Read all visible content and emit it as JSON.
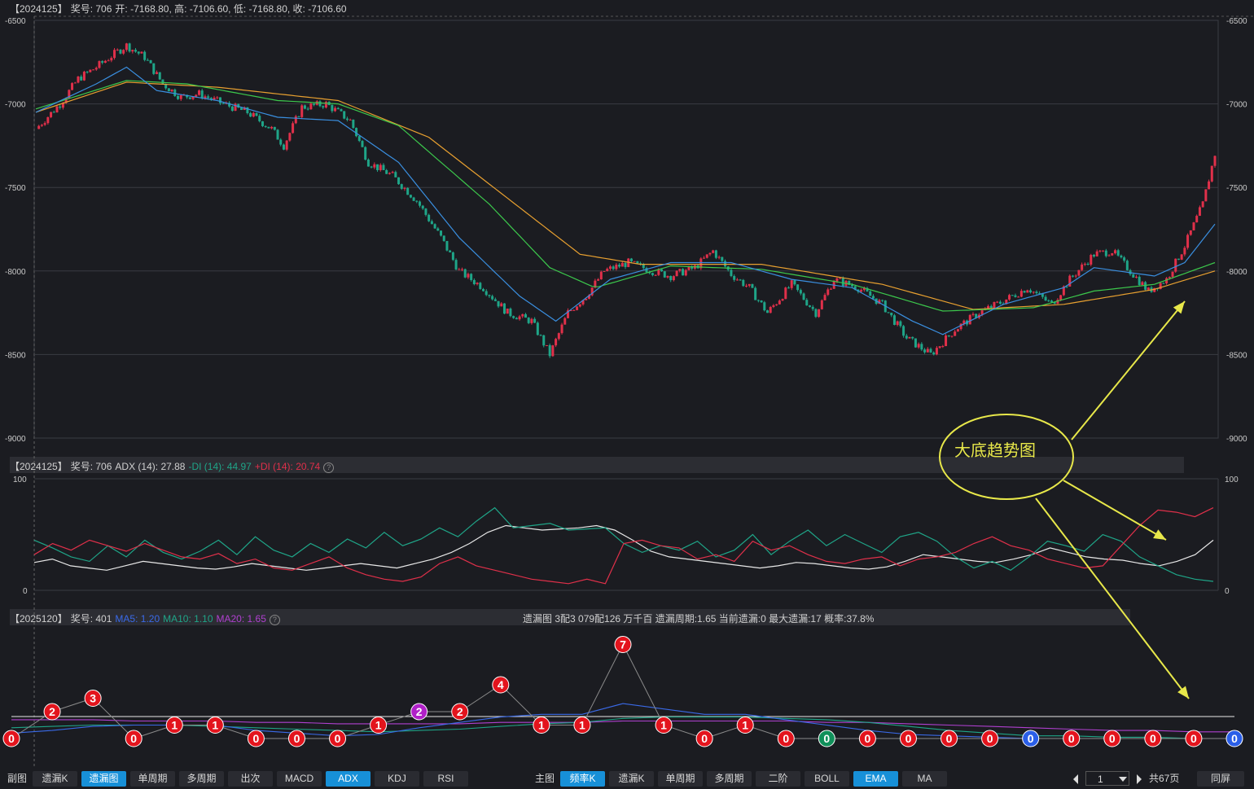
{
  "main_header": {
    "code": "【2024125】",
    "issue": "奖号: 706",
    "ohlc": "开: -7168.80, 高: -7106.60, 低: -7168.80, 收: -7106.60"
  },
  "adx_header": {
    "code": "【2024125】",
    "issue": "奖号: 706",
    "adx": "ADX (14): 27.88",
    "mdi": "-DI (14): 44.97",
    "pdi": "+DI (14): 20.74",
    "help": "?"
  },
  "omit_header": {
    "code": "【2025120】",
    "issue": "奖号: 401",
    "ma5": "MA5: 1.20",
    "ma10": "MA10: 1.10",
    "ma20": "MA20: 1.65",
    "help": "?",
    "info": "遗漏图   3配3   079配126   万千百   遗漏周期:1.65   当前遗漏:0   最大遗漏:17   概率:37.8%"
  },
  "annotation": {
    "text": "大底趋势图"
  },
  "colors": {
    "up": "#e0304a",
    "down": "#1fa588",
    "ma_blue": "#3a8fe0",
    "ma_green": "#3cc84c",
    "ma_orange": "#e8a030",
    "adx_white": "#e8e8e8",
    "annot_yellow": "#e8e84a"
  },
  "chart_data": [
    {
      "type": "candlestick",
      "name": "main",
      "ylim": [
        -9000,
        -6500
      ],
      "yticks": [
        -6500,
        -7000,
        -7500,
        -8000,
        -8500,
        -9000
      ],
      "ytick_labels": [
        "-6500",
        "-7000",
        "-7500",
        "-8000",
        "-8500",
        "-9000"
      ],
      "close_path": [
        [
          0,
          -7150
        ],
        [
          8,
          -7000
        ],
        [
          14,
          -6850
        ],
        [
          20,
          -6780
        ],
        [
          26,
          -6700
        ],
        [
          30,
          -6650
        ],
        [
          36,
          -6720
        ],
        [
          42,
          -6880
        ],
        [
          48,
          -6960
        ],
        [
          54,
          -6940
        ],
        [
          62,
          -7000
        ],
        [
          70,
          -7050
        ],
        [
          78,
          -7150
        ],
        [
          82,
          -7250
        ],
        [
          88,
          -7020
        ],
        [
          96,
          -7000
        ],
        [
          104,
          -7100
        ],
        [
          110,
          -7350
        ],
        [
          118,
          -7430
        ],
        [
          126,
          -7580
        ],
        [
          134,
          -7800
        ],
        [
          140,
          -8000
        ],
        [
          148,
          -8100
        ],
        [
          156,
          -8250
        ],
        [
          164,
          -8300
        ],
        [
          170,
          -8500
        ],
        [
          176,
          -8250
        ],
        [
          182,
          -8150
        ],
        [
          188,
          -8000
        ],
        [
          196,
          -7950
        ],
        [
          204,
          -8000
        ],
        [
          210,
          -8030
        ],
        [
          218,
          -7980
        ],
        [
          224,
          -7880
        ],
        [
          230,
          -8020
        ],
        [
          236,
          -8100
        ],
        [
          242,
          -8250
        ],
        [
          250,
          -8080
        ],
        [
          258,
          -8250
        ],
        [
          264,
          -8050
        ],
        [
          272,
          -8100
        ],
        [
          280,
          -8200
        ],
        [
          288,
          -8400
        ],
        [
          296,
          -8500
        ],
        [
          304,
          -8350
        ],
        [
          312,
          -8250
        ],
        [
          320,
          -8180
        ],
        [
          328,
          -8100
        ],
        [
          336,
          -8200
        ],
        [
          342,
          -8050
        ],
        [
          350,
          -7900
        ],
        [
          356,
          -7880
        ],
        [
          362,
          -8000
        ],
        [
          368,
          -8120
        ],
        [
          374,
          -8050
        ],
        [
          380,
          -7850
        ],
        [
          386,
          -7600
        ],
        [
          390,
          -7300
        ]
      ],
      "ma_blue_path": [
        [
          0,
          -7050
        ],
        [
          20,
          -6880
        ],
        [
          30,
          -6780
        ],
        [
          40,
          -6920
        ],
        [
          60,
          -6980
        ],
        [
          80,
          -7080
        ],
        [
          100,
          -7100
        ],
        [
          120,
          -7350
        ],
        [
          140,
          -7800
        ],
        [
          160,
          -8150
        ],
        [
          172,
          -8300
        ],
        [
          190,
          -8050
        ],
        [
          210,
          -7950
        ],
        [
          230,
          -7950
        ],
        [
          250,
          -8050
        ],
        [
          270,
          -8100
        ],
        [
          290,
          -8300
        ],
        [
          300,
          -8380
        ],
        [
          320,
          -8200
        ],
        [
          340,
          -8100
        ],
        [
          350,
          -7980
        ],
        [
          370,
          -8030
        ],
        [
          380,
          -7950
        ],
        [
          390,
          -7720
        ]
      ],
      "ma_green_path": [
        [
          0,
          -7030
        ],
        [
          30,
          -6860
        ],
        [
          50,
          -6880
        ],
        [
          80,
          -6980
        ],
        [
          100,
          -7000
        ],
        [
          120,
          -7130
        ],
        [
          150,
          -7600
        ],
        [
          170,
          -7980
        ],
        [
          185,
          -8100
        ],
        [
          210,
          -7970
        ],
        [
          240,
          -7990
        ],
        [
          270,
          -8080
        ],
        [
          300,
          -8240
        ],
        [
          330,
          -8220
        ],
        [
          350,
          -8120
        ],
        [
          370,
          -8080
        ],
        [
          390,
          -7950
        ]
      ],
      "ma_orange_path": [
        [
          0,
          -7050
        ],
        [
          30,
          -6870
        ],
        [
          60,
          -6900
        ],
        [
          100,
          -6980
        ],
        [
          130,
          -7200
        ],
        [
          160,
          -7620
        ],
        [
          180,
          -7900
        ],
        [
          200,
          -7960
        ],
        [
          240,
          -7960
        ],
        [
          280,
          -8080
        ],
        [
          310,
          -8230
        ],
        [
          340,
          -8200
        ],
        [
          370,
          -8110
        ],
        [
          390,
          -8000
        ]
      ]
    },
    {
      "type": "line",
      "name": "adx",
      "ylim": [
        0,
        100
      ],
      "yticks": [
        0,
        100
      ],
      "ytick_labels": [
        "0",
        "100"
      ],
      "series": [
        {
          "name": "ADX (14)",
          "color": "#e8e8e8",
          "values": [
            25,
            28,
            22,
            20,
            18,
            22,
            26,
            24,
            22,
            20,
            19,
            21,
            24,
            22,
            20,
            18,
            20,
            22,
            24,
            22,
            20,
            24,
            28,
            34,
            42,
            52,
            58,
            56,
            54,
            55,
            56,
            58,
            54,
            45,
            35,
            30,
            28,
            26,
            24,
            22,
            20,
            22,
            25,
            24,
            22,
            20,
            19,
            21,
            26,
            32,
            30,
            28,
            26,
            25,
            28,
            32,
            38,
            34,
            30,
            28,
            27,
            24,
            22,
            26,
            32,
            45
          ]
        },
        {
          "name": "-DI (14)",
          "color": "#1fa588",
          "values": [
            45,
            38,
            30,
            26,
            40,
            30,
            45,
            34,
            28,
            35,
            45,
            32,
            48,
            36,
            30,
            42,
            34,
            46,
            38,
            52,
            40,
            46,
            56,
            48,
            62,
            74,
            56,
            58,
            60,
            54,
            55,
            56,
            42,
            34,
            40,
            36,
            44,
            30,
            36,
            50,
            32,
            44,
            54,
            40,
            50,
            42,
            34,
            48,
            52,
            44,
            30,
            20,
            26,
            18,
            30,
            44,
            40,
            35,
            50,
            44,
            30,
            22,
            14,
            10,
            8
          ]
        },
        {
          "name": "+DI (14)",
          "color": "#e0304a",
          "values": [
            32,
            42,
            36,
            45,
            40,
            35,
            42,
            36,
            30,
            28,
            33,
            24,
            28,
            20,
            18,
            24,
            30,
            20,
            14,
            10,
            8,
            12,
            24,
            30,
            22,
            18,
            14,
            10,
            8,
            6,
            10,
            6,
            42,
            45,
            40,
            38,
            28,
            32,
            26,
            44,
            36,
            40,
            32,
            26,
            24,
            28,
            30,
            22,
            28,
            30,
            34,
            42,
            48,
            40,
            36,
            28,
            24,
            20,
            22,
            40,
            58,
            72,
            70,
            66,
            74
          ]
        }
      ]
    },
    {
      "type": "line",
      "name": "omission",
      "values": [
        0,
        2,
        3,
        0,
        1,
        1,
        0,
        0,
        0,
        1,
        2,
        2,
        4,
        1,
        1,
        7,
        1,
        0,
        1,
        0,
        0,
        0,
        0,
        0,
        0,
        0,
        0,
        0,
        0,
        0,
        0
      ],
      "point_colors": [
        "red",
        "red",
        "red",
        "red",
        "red",
        "red",
        "red",
        "red",
        "red",
        "red",
        "purple",
        "red",
        "red",
        "red",
        "red",
        "red",
        "red",
        "red",
        "red",
        "red",
        "green",
        "red",
        "red",
        "red",
        "red",
        "blue",
        "red",
        "red",
        "red",
        "red",
        "blue"
      ],
      "ma5": [
        0.4,
        0.6,
        0.9,
        1.0,
        1.0,
        1.0,
        0.6,
        0.4,
        0.2,
        0.3,
        0.8,
        1.2,
        1.6,
        1.8,
        1.8,
        2.6,
        2.2,
        1.8,
        1.8,
        1.4,
        1.0,
        0.6,
        0.3,
        0.2,
        0.1,
        0.0,
        0.0,
        0.0,
        0.0,
        0.0,
        0.0
      ],
      "ma10": [
        0.8,
        0.9,
        1.0,
        1.0,
        1.0,
        0.9,
        0.8,
        0.7,
        0.6,
        0.5,
        0.6,
        0.7,
        0.9,
        1.1,
        1.2,
        1.5,
        1.6,
        1.6,
        1.6,
        1.5,
        1.4,
        1.2,
        0.9,
        0.6,
        0.4,
        0.2,
        0.2,
        0.1,
        0.1,
        0.0,
        0.0
      ],
      "ma20": [
        1.4,
        1.4,
        1.4,
        1.3,
        1.3,
        1.3,
        1.2,
        1.2,
        1.1,
        1.1,
        1.1,
        1.1,
        1.2,
        1.2,
        1.2,
        1.3,
        1.3,
        1.3,
        1.3,
        1.3,
        1.2,
        1.2,
        1.1,
        1.0,
        0.9,
        0.8,
        0.7,
        0.6,
        0.6,
        0.5,
        0.5
      ]
    }
  ],
  "bottom_left": [
    {
      "label": "副图",
      "type": "label"
    },
    {
      "label": "遗漏K",
      "active": false
    },
    {
      "label": "遗漏图",
      "active": true
    },
    {
      "label": "单周期",
      "active": false
    },
    {
      "label": "多周期",
      "active": false
    },
    {
      "label": "出次",
      "active": false
    },
    {
      "label": "MACD",
      "active": false
    },
    {
      "label": "ADX",
      "active": true
    },
    {
      "label": "KDJ",
      "active": false
    },
    {
      "label": "RSI",
      "active": false
    }
  ],
  "bottom_right": [
    {
      "label": "主图",
      "type": "label"
    },
    {
      "label": "频率K",
      "active": true
    },
    {
      "label": "遗漏K",
      "active": false
    },
    {
      "label": "单周期",
      "active": false
    },
    {
      "label": "多周期",
      "active": false
    },
    {
      "label": "二阶",
      "active": false
    },
    {
      "label": "BOLL",
      "active": false
    },
    {
      "label": "EMA",
      "active": true
    },
    {
      "label": "MA",
      "active": false
    }
  ],
  "pager": {
    "page": "1",
    "total": "共67页",
    "fullscreen": "同屏"
  }
}
